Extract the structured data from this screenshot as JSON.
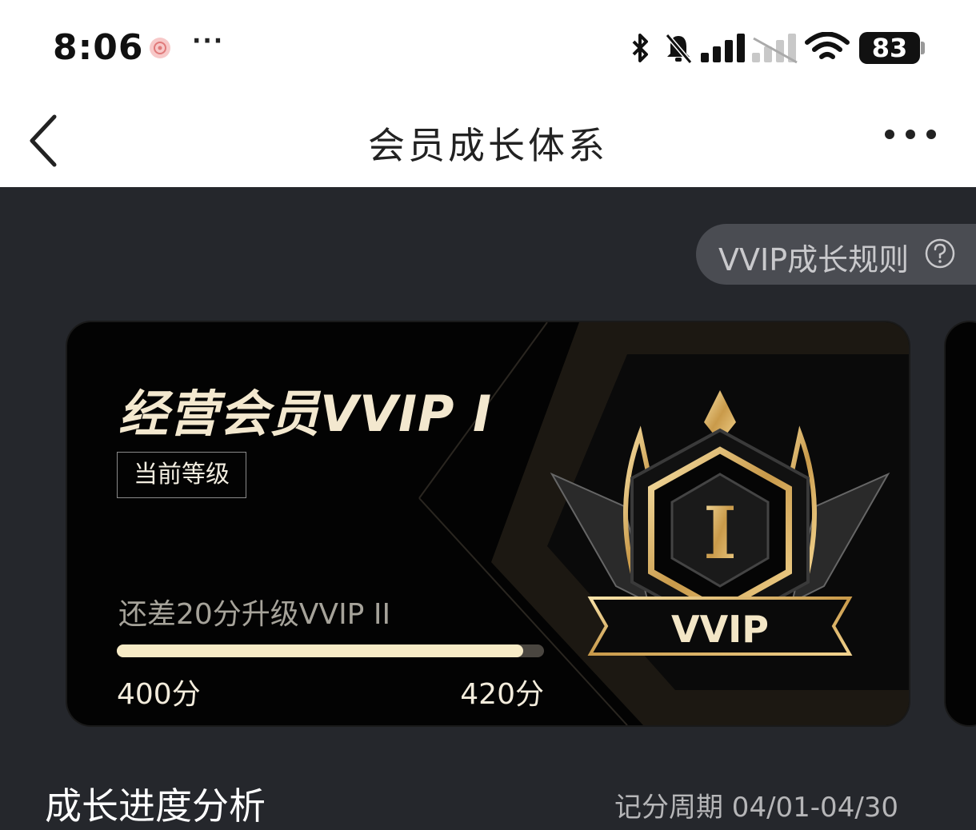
{
  "status_bar": {
    "time": "8:06",
    "more": "···",
    "battery": "83",
    "icons": [
      "notification-app-icon",
      "bluetooth-icon",
      "mute-bell-icon",
      "signal-icon",
      "signal-weak-icon",
      "wifi-icon",
      "battery-icon"
    ]
  },
  "nav": {
    "title": "会员成长体系",
    "back_icon": "chevron-left-icon",
    "more_icon": "more-horizontal-icon"
  },
  "rules": {
    "label": "VVIP成长规则",
    "icon": "question-circle-icon"
  },
  "card": {
    "level_title": "经营会员VVIP I",
    "badge": "当前等级",
    "upgrade_hint": "还差20分升级VVIP II",
    "progress": 0.952,
    "score_current": "400分",
    "score_target": "420分",
    "emblem_numeral": "I",
    "emblem_ribbon": "VVIP"
  },
  "section": {
    "title": "成长进度分析",
    "period": "记分周期 04/01-04/30"
  },
  "colors": {
    "page_bg": "#25272c",
    "card_bg": "#030303",
    "gold": "#d9b46a",
    "cream": "#f7ebc6"
  }
}
